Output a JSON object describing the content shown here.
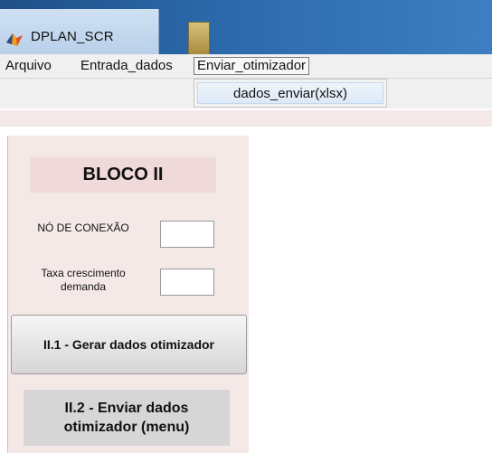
{
  "window": {
    "title": "DPLAN_SCR",
    "icon": "matlab-icon",
    "taskbar_thumbnail": "folder-thumbnail-icon"
  },
  "menubar": {
    "items": [
      "Arquivo",
      "Entrada_dados",
      "Enviar_otimizador"
    ],
    "active_index": 2
  },
  "dropdown": {
    "items": [
      "dados_enviar(xlsx)"
    ]
  },
  "panel": {
    "block_title": "BLOCO II",
    "fields": [
      {
        "label": "NÓ DE CONEXÃO",
        "value": ""
      },
      {
        "label": "Taxa crescimento\ndemanda",
        "value": ""
      }
    ],
    "button_generate": "II.1 - Gerar dados otimizador",
    "button_send": "II.2 - Enviar dados\notimizador (menu)"
  },
  "colors": {
    "titlebar": "#2a67a8",
    "panel_bg": "#f5e9e8",
    "block_title_bg": "#efd9d9",
    "button_send_bg": "#d6d6d6"
  }
}
